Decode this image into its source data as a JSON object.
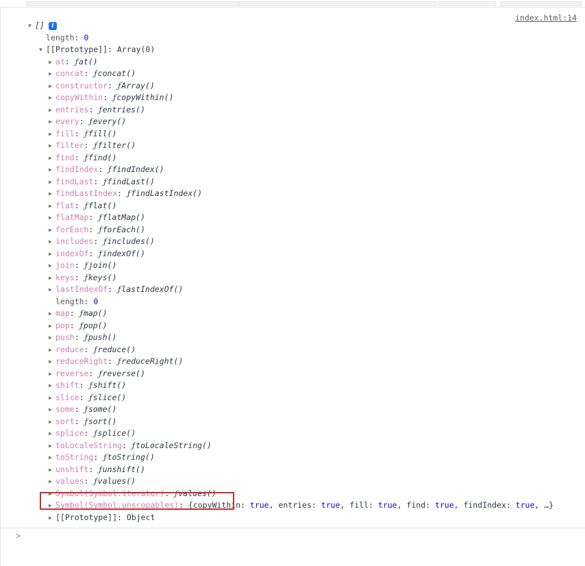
{
  "toolbar": {
    "segments": [
      "filter-bar",
      "level-selector",
      "settings-group",
      "close-group"
    ]
  },
  "console": {
    "source_link": "index.html:14",
    "root": {
      "preview": "[]",
      "info_icon": "info-icon",
      "info_glyph": "i"
    },
    "prompt": {
      "caret": ">",
      "value": "",
      "placeholder": ""
    }
  },
  "highlight": {
    "color": "#c4302b",
    "target": "Symbol(Symbol.iterator): ƒ values()"
  },
  "rows": [
    {
      "level": 1,
      "arrow": "none",
      "key": "length",
      "keyclass": "key-plain",
      "sep": ": ",
      "value": "0",
      "valclass": "num"
    },
    {
      "level": 1,
      "arrow": "open",
      "key": "[[Prototype]]",
      "keyclass": "proto-name",
      "sep": ": ",
      "value": "Array(0)",
      "valclass": "plain"
    },
    {
      "level": 2,
      "arrow": "closed",
      "key": "at",
      "keyclass": "prop-name",
      "sep": ": ",
      "fn": "at()"
    },
    {
      "level": 2,
      "arrow": "closed",
      "key": "concat",
      "keyclass": "prop-name",
      "sep": ": ",
      "fn": "concat()"
    },
    {
      "level": 2,
      "arrow": "closed",
      "key": "constructor",
      "keyclass": "prop-name",
      "sep": ": ",
      "fn": "Array()"
    },
    {
      "level": 2,
      "arrow": "closed",
      "key": "copyWithin",
      "keyclass": "prop-name",
      "sep": ": ",
      "fn": "copyWithin()"
    },
    {
      "level": 2,
      "arrow": "closed",
      "key": "entries",
      "keyclass": "prop-name",
      "sep": ": ",
      "fn": "entries()"
    },
    {
      "level": 2,
      "arrow": "closed",
      "key": "every",
      "keyclass": "prop-name",
      "sep": ": ",
      "fn": "every()"
    },
    {
      "level": 2,
      "arrow": "closed",
      "key": "fill",
      "keyclass": "prop-name",
      "sep": ": ",
      "fn": "fill()"
    },
    {
      "level": 2,
      "arrow": "closed",
      "key": "filter",
      "keyclass": "prop-name",
      "sep": ": ",
      "fn": "filter()"
    },
    {
      "level": 2,
      "arrow": "closed",
      "key": "find",
      "keyclass": "prop-name",
      "sep": ": ",
      "fn": "find()"
    },
    {
      "level": 2,
      "arrow": "closed",
      "key": "findIndex",
      "keyclass": "prop-name",
      "sep": ": ",
      "fn": "findIndex()"
    },
    {
      "level": 2,
      "arrow": "closed",
      "key": "findLast",
      "keyclass": "prop-name",
      "sep": ": ",
      "fn": "findLast()"
    },
    {
      "level": 2,
      "arrow": "closed",
      "key": "findLastIndex",
      "keyclass": "prop-name",
      "sep": ": ",
      "fn": "findLastIndex()"
    },
    {
      "level": 2,
      "arrow": "closed",
      "key": "flat",
      "keyclass": "prop-name",
      "sep": ": ",
      "fn": "flat()"
    },
    {
      "level": 2,
      "arrow": "closed",
      "key": "flatMap",
      "keyclass": "prop-name",
      "sep": ": ",
      "fn": "flatMap()"
    },
    {
      "level": 2,
      "arrow": "closed",
      "key": "forEach",
      "keyclass": "prop-name",
      "sep": ": ",
      "fn": "forEach()"
    },
    {
      "level": 2,
      "arrow": "closed",
      "key": "includes",
      "keyclass": "prop-name",
      "sep": ": ",
      "fn": "includes()"
    },
    {
      "level": 2,
      "arrow": "closed",
      "key": "indexOf",
      "keyclass": "prop-name",
      "sep": ": ",
      "fn": "indexOf()"
    },
    {
      "level": 2,
      "arrow": "closed",
      "key": "join",
      "keyclass": "prop-name",
      "sep": ": ",
      "fn": "join()"
    },
    {
      "level": 2,
      "arrow": "closed",
      "key": "keys",
      "keyclass": "prop-name",
      "sep": ": ",
      "fn": "keys()"
    },
    {
      "level": 2,
      "arrow": "closed",
      "key": "lastIndexOf",
      "keyclass": "prop-name",
      "sep": ": ",
      "fn": "lastIndexOf()"
    },
    {
      "level": 2,
      "arrow": "none",
      "key": "length",
      "keyclass": "key-plain",
      "sep": ": ",
      "value": "0",
      "valclass": "num"
    },
    {
      "level": 2,
      "arrow": "closed",
      "key": "map",
      "keyclass": "prop-name",
      "sep": ": ",
      "fn": "map()"
    },
    {
      "level": 2,
      "arrow": "closed",
      "key": "pop",
      "keyclass": "prop-name",
      "sep": ": ",
      "fn": "pop()"
    },
    {
      "level": 2,
      "arrow": "closed",
      "key": "push",
      "keyclass": "prop-name",
      "sep": ": ",
      "fn": "push()"
    },
    {
      "level": 2,
      "arrow": "closed",
      "key": "reduce",
      "keyclass": "prop-name",
      "sep": ": ",
      "fn": "reduce()"
    },
    {
      "level": 2,
      "arrow": "closed",
      "key": "reduceRight",
      "keyclass": "prop-name",
      "sep": ": ",
      "fn": "reduceRight()"
    },
    {
      "level": 2,
      "arrow": "closed",
      "key": "reverse",
      "keyclass": "prop-name",
      "sep": ": ",
      "fn": "reverse()"
    },
    {
      "level": 2,
      "arrow": "closed",
      "key": "shift",
      "keyclass": "prop-name",
      "sep": ": ",
      "fn": "shift()"
    },
    {
      "level": 2,
      "arrow": "closed",
      "key": "slice",
      "keyclass": "prop-name",
      "sep": ": ",
      "fn": "slice()"
    },
    {
      "level": 2,
      "arrow": "closed",
      "key": "some",
      "keyclass": "prop-name",
      "sep": ": ",
      "fn": "some()"
    },
    {
      "level": 2,
      "arrow": "closed",
      "key": "sort",
      "keyclass": "prop-name",
      "sep": ": ",
      "fn": "sort()"
    },
    {
      "level": 2,
      "arrow": "closed",
      "key": "splice",
      "keyclass": "prop-name",
      "sep": ": ",
      "fn": "splice()"
    },
    {
      "level": 2,
      "arrow": "closed",
      "key": "toLocaleString",
      "keyclass": "prop-name",
      "sep": ": ",
      "fn": "toLocaleString()"
    },
    {
      "level": 2,
      "arrow": "closed",
      "key": "toString",
      "keyclass": "prop-name",
      "sep": ": ",
      "fn": "toString()"
    },
    {
      "level": 2,
      "arrow": "closed",
      "key": "unshift",
      "keyclass": "prop-name",
      "sep": ": ",
      "fn": "unshift()"
    },
    {
      "level": 2,
      "arrow": "closed",
      "key": "values",
      "keyclass": "prop-name",
      "sep": ": ",
      "fn": "values()"
    },
    {
      "level": 2,
      "arrow": "closed",
      "key": "Symbol(Symbol.iterator)",
      "keyclass": "prop-name",
      "sep": ": ",
      "fn": "values()"
    },
    {
      "level": 2,
      "arrow": "closed",
      "key": "Symbol(Symbol.unscopables)",
      "keyclass": "prop-name",
      "sep": ": ",
      "objpreview": [
        {
          "t": "{copyWithin: ",
          "c": "plain"
        },
        {
          "t": "true",
          "c": "bool"
        },
        {
          "t": ", entries: ",
          "c": "plain"
        },
        {
          "t": "true",
          "c": "bool"
        },
        {
          "t": ", fill: ",
          "c": "plain"
        },
        {
          "t": "true",
          "c": "bool"
        },
        {
          "t": ", find: ",
          "c": "plain"
        },
        {
          "t": "true",
          "c": "bool"
        },
        {
          "t": ", findIndex: ",
          "c": "plain"
        },
        {
          "t": "true",
          "c": "bool"
        },
        {
          "t": ", …}",
          "c": "plain"
        }
      ]
    },
    {
      "level": 2,
      "arrow": "closed",
      "key": "[[Prototype]]",
      "keyclass": "proto-name",
      "sep": ": ",
      "value": "Object",
      "valclass": "plain"
    }
  ]
}
